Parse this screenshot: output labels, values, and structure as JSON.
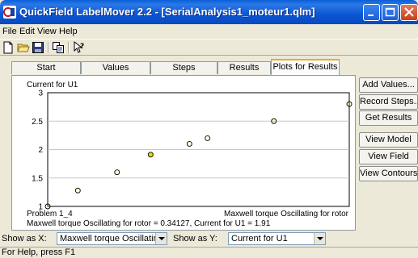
{
  "window": {
    "title": "QuickField LabelMover 2.2 - [SerialAnalysis1_moteur1.qlm]",
    "buttons": [
      "minimize",
      "maximize",
      "close"
    ]
  },
  "menu": [
    "File",
    "Edit",
    "View",
    "Help"
  ],
  "toolbar": {
    "icons": [
      "new-file-icon",
      "open-folder-icon",
      "save-icon",
      "copy-icon",
      "help-cursor-icon"
    ]
  },
  "tabs": [
    {
      "label": "Start",
      "active": false
    },
    {
      "label": "Values",
      "active": false
    },
    {
      "label": "Steps",
      "active": false
    },
    {
      "label": "Results",
      "active": false
    },
    {
      "label": "Plots for Results",
      "active": true
    }
  ],
  "side_buttons": {
    "add_values": "Add Values...",
    "record_steps": "Record Steps...",
    "get_results": "Get Results",
    "view_model": "View Model",
    "view_field": "View Field",
    "view_contours": "View Contours..."
  },
  "plot": {
    "problem_label": "Problem 1_4",
    "cursor_readout": "Maxwell torque Oscillating for rotor = 0.34127, Current for U1 = 1.91",
    "marker_color": "#ffff00",
    "highlight_color": "#dddd00"
  },
  "chart_data": {
    "type": "scatter",
    "title": "",
    "xlabel": "Maxwell torque Oscillating for rotor",
    "ylabel": "Current for U1",
    "ylim": [
      1,
      3
    ],
    "xlim": [
      0,
      1
    ],
    "yticks": [
      "3",
      "2.5",
      "2",
      "1.5",
      "1"
    ],
    "grid": true,
    "series": [
      {
        "x": [
          0.0,
          0.1,
          0.23,
          0.34127,
          0.47,
          0.53,
          0.75,
          1.0
        ],
        "y": [
          1.0,
          1.28,
          1.6,
          1.91,
          2.1,
          2.2,
          2.5,
          2.8
        ],
        "selected_index": 3
      }
    ]
  },
  "show_as": {
    "x_label": "Show as X:",
    "x_value": "Maxwell torque Oscillating for",
    "y_label": "Show as Y:",
    "y_value": "Current for U1"
  },
  "status": "For Help, press F1"
}
